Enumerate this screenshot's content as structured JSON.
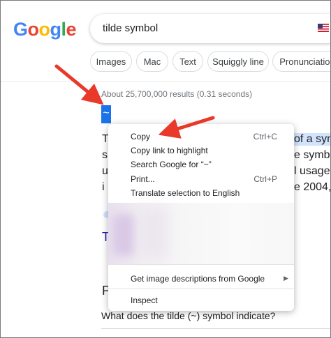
{
  "logo": {
    "text": "Google",
    "letters": [
      "G",
      "o",
      "o",
      "g",
      "l",
      "e"
    ],
    "colors": [
      "#4285f4",
      "#ea4335",
      "#fbbc05",
      "#4285f4",
      "#34a853",
      "#ea4335"
    ]
  },
  "search": {
    "query": "tilde symbol"
  },
  "chips": [
    "Images",
    "Mac",
    "Text",
    "Squiggly line",
    "Pronunciation"
  ],
  "results": {
    "stats": "About 25,700,000 results (0.31 seconds)"
  },
  "selection": {
    "text": "~"
  },
  "snippet": {
    "left_chars": [
      "T",
      "s",
      "u",
      "i"
    ],
    "right_lines": [
      "of a sym",
      "e symbo",
      "l usage",
      "e 2004,"
    ],
    "link_letter": "T"
  },
  "section": {
    "letter": "P"
  },
  "people_also_ask": {
    "question": "What does the tilde (~) symbol indicate?"
  },
  "context_menu": {
    "items": [
      {
        "label": "Copy",
        "shortcut": "Ctrl+C"
      },
      {
        "label": "Copy link to highlight",
        "shortcut": ""
      },
      {
        "label": "Search Google for “~”",
        "shortcut": ""
      },
      {
        "label": "Print...",
        "shortcut": "Ctrl+P"
      },
      {
        "label": "Translate selection to English",
        "shortcut": ""
      }
    ],
    "image_descriptions": "Get image descriptions from Google",
    "inspect": "Inspect"
  },
  "colors": {
    "accent": "#1a73e8",
    "arrow": "#e8392a",
    "link": "#1a0dab"
  }
}
